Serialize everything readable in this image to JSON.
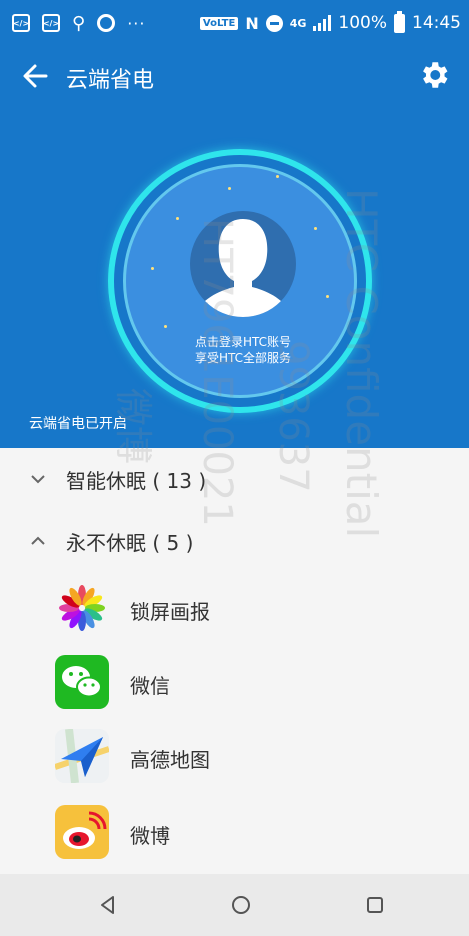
{
  "status_bar": {
    "icon_names": [
      "code-icon",
      "code-icon",
      "usb-icon",
      "sync-icon",
      "more-dots-icon"
    ],
    "dots": "···",
    "volte": "VoLTE",
    "nfc": "N",
    "network": "4G",
    "battery_percent": "100%",
    "time": "14:45"
  },
  "app_bar": {
    "back_icon": "arrow-back-icon",
    "title": "云端省电",
    "settings_icon": "gear-icon"
  },
  "hero": {
    "login_line1": "点击登录HTC账号",
    "login_line2": "享受HTC全部服务",
    "status": "云端省电已开启"
  },
  "groups": [
    {
      "label": "智能休眠 ( 13 )",
      "expanded": false
    },
    {
      "label": "永不休眠 ( 5 )",
      "expanded": true
    }
  ],
  "apps": [
    {
      "label": "锁屏画报",
      "icon": "lockscreen-pictorial-icon"
    },
    {
      "label": "微信",
      "icon": "wechat-icon"
    },
    {
      "label": "高德地图",
      "icon": "amap-icon"
    },
    {
      "label": "微博",
      "icon": "weibo-icon"
    }
  ],
  "nav_bar": {
    "back": "nav-back-icon",
    "home": "nav-home-icon",
    "recents": "nav-recents-icon"
  },
  "watermarks": [
    "HTC Confidential",
    "HT7961E00021",
    "993637",
    "微博"
  ],
  "colors": {
    "header_blue": "#1777c9",
    "ring_cyan": "#2fe5ec",
    "wechat_green": "#1fb922",
    "weibo_yellow": "#f6c13c"
  }
}
